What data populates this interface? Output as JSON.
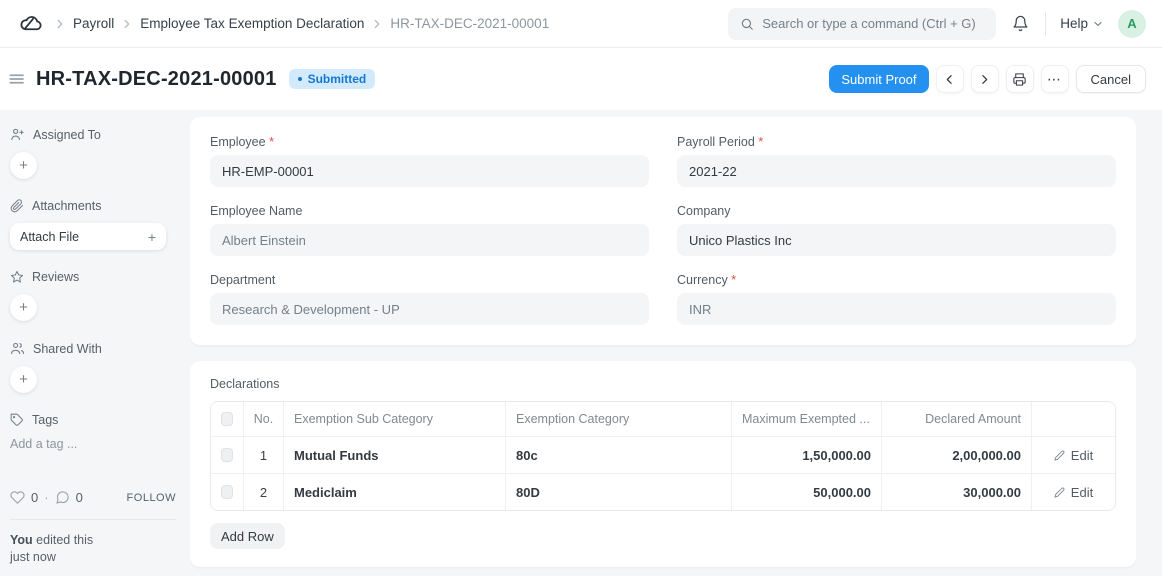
{
  "navbar": {
    "breadcrumb": [
      "Payroll",
      "Employee Tax Exemption Declaration",
      "HR-TAX-DEC-2021-00001"
    ],
    "search_placeholder": "Search or type a command (Ctrl + G)",
    "help_label": "Help",
    "avatar_letter": "A"
  },
  "page_header": {
    "title": "HR-TAX-DEC-2021-00001",
    "status_badge": "Submitted",
    "primary_button": "Submit Proof",
    "cancel_button": "Cancel"
  },
  "sidebar": {
    "assigned_to_label": "Assigned To",
    "attachments_label": "Attachments",
    "attach_file_label": "Attach File",
    "reviews_label": "Reviews",
    "shared_with_label": "Shared With",
    "tags_label": "Tags",
    "add_tag_placeholder": "Add a tag ...",
    "likes_count": "0",
    "comments_count": "0",
    "follow_label": "FOLLOW",
    "edited_by": "You",
    "edited_action": "edited this",
    "edited_time": "just now"
  },
  "form": {
    "required_marker": "*",
    "fields": [
      {
        "label": "Employee",
        "value": "HR-EMP-00001"
      },
      {
        "label": "Payroll Period",
        "value": "2021-22"
      },
      {
        "label": "Employee Name",
        "value": "Albert Einstein"
      },
      {
        "label": "Company",
        "value": "Unico Plastics Inc"
      },
      {
        "label": "Department",
        "value": "Research & Development - UP"
      },
      {
        "label": "Currency",
        "value": "INR"
      }
    ]
  },
  "declarations": {
    "section_label": "Declarations",
    "columns": {
      "no": "No.",
      "sub_category": "Exemption Sub Category",
      "category": "Exemption Category",
      "max_exempted": "Maximum Exempted ...",
      "declared": "Declared Amount"
    },
    "rows": [
      {
        "no": "1",
        "sub_category": "Mutual Funds",
        "category": "80c",
        "max_exempted": "1,50,000.00",
        "declared": "2,00,000.00",
        "edit_label": "Edit"
      },
      {
        "no": "2",
        "sub_category": "Mediclaim",
        "category": "80D",
        "max_exempted": "50,000.00",
        "declared": "30,000.00",
        "edit_label": "Edit"
      }
    ],
    "add_row_label": "Add Row"
  },
  "colors": {
    "primary": "#2490ef",
    "badge_bg": "#d3e9fc",
    "badge_text": "#1579d0",
    "avatar_bg": "#d9f1e3",
    "avatar_text": "#2c9a68"
  }
}
